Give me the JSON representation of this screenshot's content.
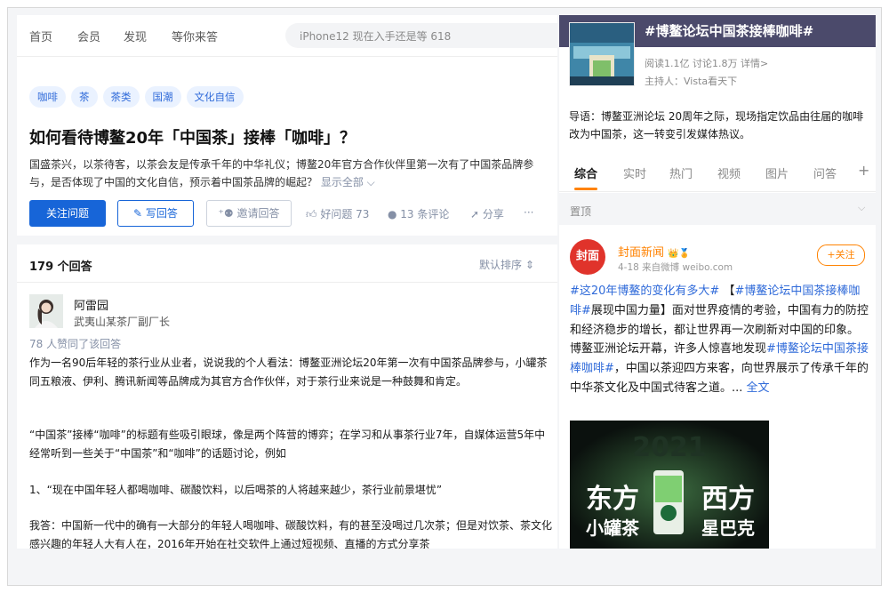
{
  "nav": {
    "items": [
      "首页",
      "会员",
      "发现",
      "等你来答"
    ],
    "search_placeholder": "iPhone12 现在入手还是等 618"
  },
  "question": {
    "tags": [
      "咖啡",
      "茶",
      "茶类",
      "国潮",
      "文化自信"
    ],
    "title": "如何看待博鳌20年「中国茶」接棒「咖啡」？",
    "desc": "国盛茶兴，以茶待客，以茶会友是传承千年的中华礼仪；博鳌20年官方合作伙伴里第一次有了中国茶品牌参与，是否体现了中国的文化自信，预示着中国茶品牌的崛起？",
    "show_all": "显示全部 ⌵",
    "follow_btn": "关注问题",
    "write_btn": "写回答",
    "invite_btn": "邀请回答",
    "good_q": "好问题 73",
    "comments": "13 条评论",
    "share": "分享",
    "more": "···"
  },
  "answers": {
    "count_label": "179 个回答",
    "sort_label": "默认排序",
    "author_name": "阿雷园",
    "author_bio": "武夷山某茶厂副厂长",
    "votes": "78 人赞同了该回答",
    "p1": "作为一名90后年轻的茶行业从业者，说说我的个人看法：博鳌亚洲论坛20年第一次有中国茶品牌参与，小罐茶同五粮液、伊利、腾讯新闻等品牌成为其官方合作伙伴，对于茶行业来说是一种鼓舞和肯定。",
    "p2": "“中国茶”接棒“咖啡”的标题有些吸引眼球，像是两个阵营的博弈；在学习和从事茶行业7年，自媒体运营5年中经常听到一些关于“中国茶”和“咖啡”的话题讨论，例如",
    "p3": "1、“现在中国年轻人都喝咖啡、碳酸饮料，以后喝茶的人将越来越少，茶行业前景堪忧”",
    "p4": "我答：中国新一代中的确有一大部分的年轻人喝咖啡、碳酸饮料，有的甚至没喝过几次茶；但是对饮茶、茶文化感兴趣的年轻人大有人在，2016年开始在社交软件上通过短视频、直播的方式分享茶"
  },
  "topic": {
    "title": "#博鳌论坛中国茶接棒咖啡#",
    "meta": "阅读1.1亿  讨论1.8万  详情>",
    "host": "主持人：Vista看天下",
    "guide": "导语：博鳌亚洲论坛 20周年之际，现场指定饮品由往届的咖啡改为中国茶，这一转变引发媒体热议。",
    "tabs": [
      "综合",
      "实时",
      "热门",
      "视频",
      "图片",
      "问答",
      "+"
    ],
    "pinned_label": "置顶"
  },
  "post": {
    "avatar_text": "封面",
    "name": "封面新闻",
    "badges": "👑🏅",
    "meta": "4-18  来自微博 weibo.com",
    "follow": "+关注",
    "tag1": "#这20年博鳌的变化有多大#",
    "text1": " 【",
    "tag2": "#博鳌论坛中国茶接棒咖啡#",
    "text2": "展现中国力量】面对世界疫情的考验，中国有力的防控和经济稳步的增长，都让世界再一次刷新对中国的印象。博鳌亚洲论坛开幕，许多人惊喜地发现",
    "tag3": "#博鳌论坛中国茶接棒咖啡#",
    "text3": "，中国以茶迎四方来客，向世界展示了传承千年的中华茶文化及中国式待客之道。... ",
    "full_text": "全文",
    "image_text_left": "东方",
    "image_text_right": "西方",
    "image_sub_left": "小罐茶",
    "image_sub_right": "星巴克",
    "image_year": "2021"
  },
  "colors": {
    "accent_blue": "#1765d8",
    "link_blue": "#2f6ad9",
    "weibo_orange": "#ff8200",
    "topic_band": "#4b4a6b"
  }
}
